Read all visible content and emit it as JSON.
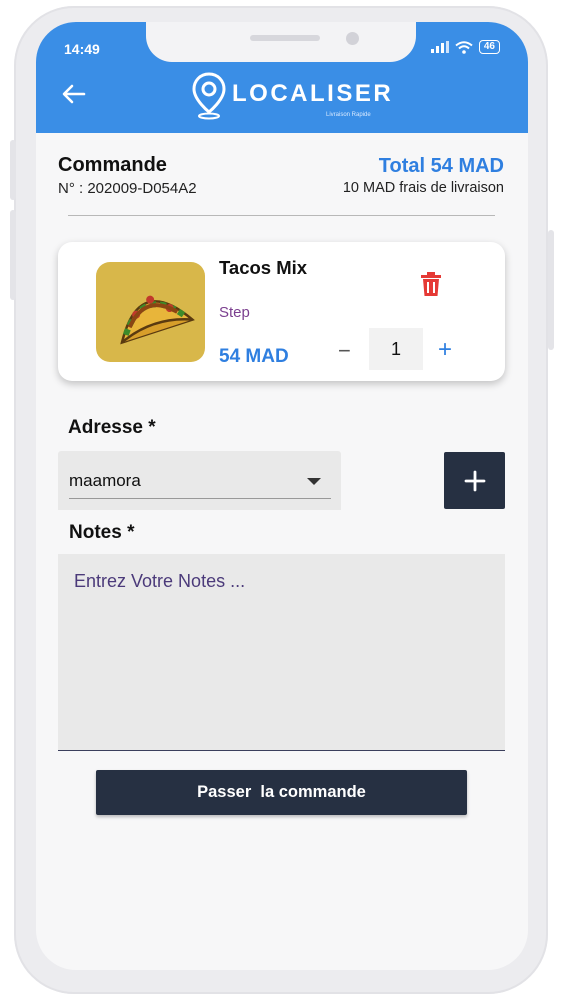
{
  "status_bar": {
    "time": "14:49",
    "battery": "46"
  },
  "app_bar": {
    "logo_text": "LOCALISER",
    "logo_sub": "Livraison Rapide"
  },
  "order": {
    "title": "Commande",
    "number": "N° : 202009-D054A2",
    "total": "Total 54 MAD",
    "delivery_fee": "10 MAD frais de livraison"
  },
  "cart_item": {
    "name": "Tacos Mix",
    "subtitle": "Step",
    "price": "54 MAD",
    "quantity": "1",
    "minus": "−",
    "plus": "+"
  },
  "address": {
    "label": "Adresse *",
    "selected": "maamora"
  },
  "notes": {
    "label": "Notes *",
    "placeholder": "Entrez Votre Notes ..."
  },
  "submit_label": "Passer  la commande",
  "colors": {
    "app_bar": "#3a8ee6",
    "accent": "#2f7fe0",
    "dark_button": "#263042",
    "delete": "#e53935"
  }
}
